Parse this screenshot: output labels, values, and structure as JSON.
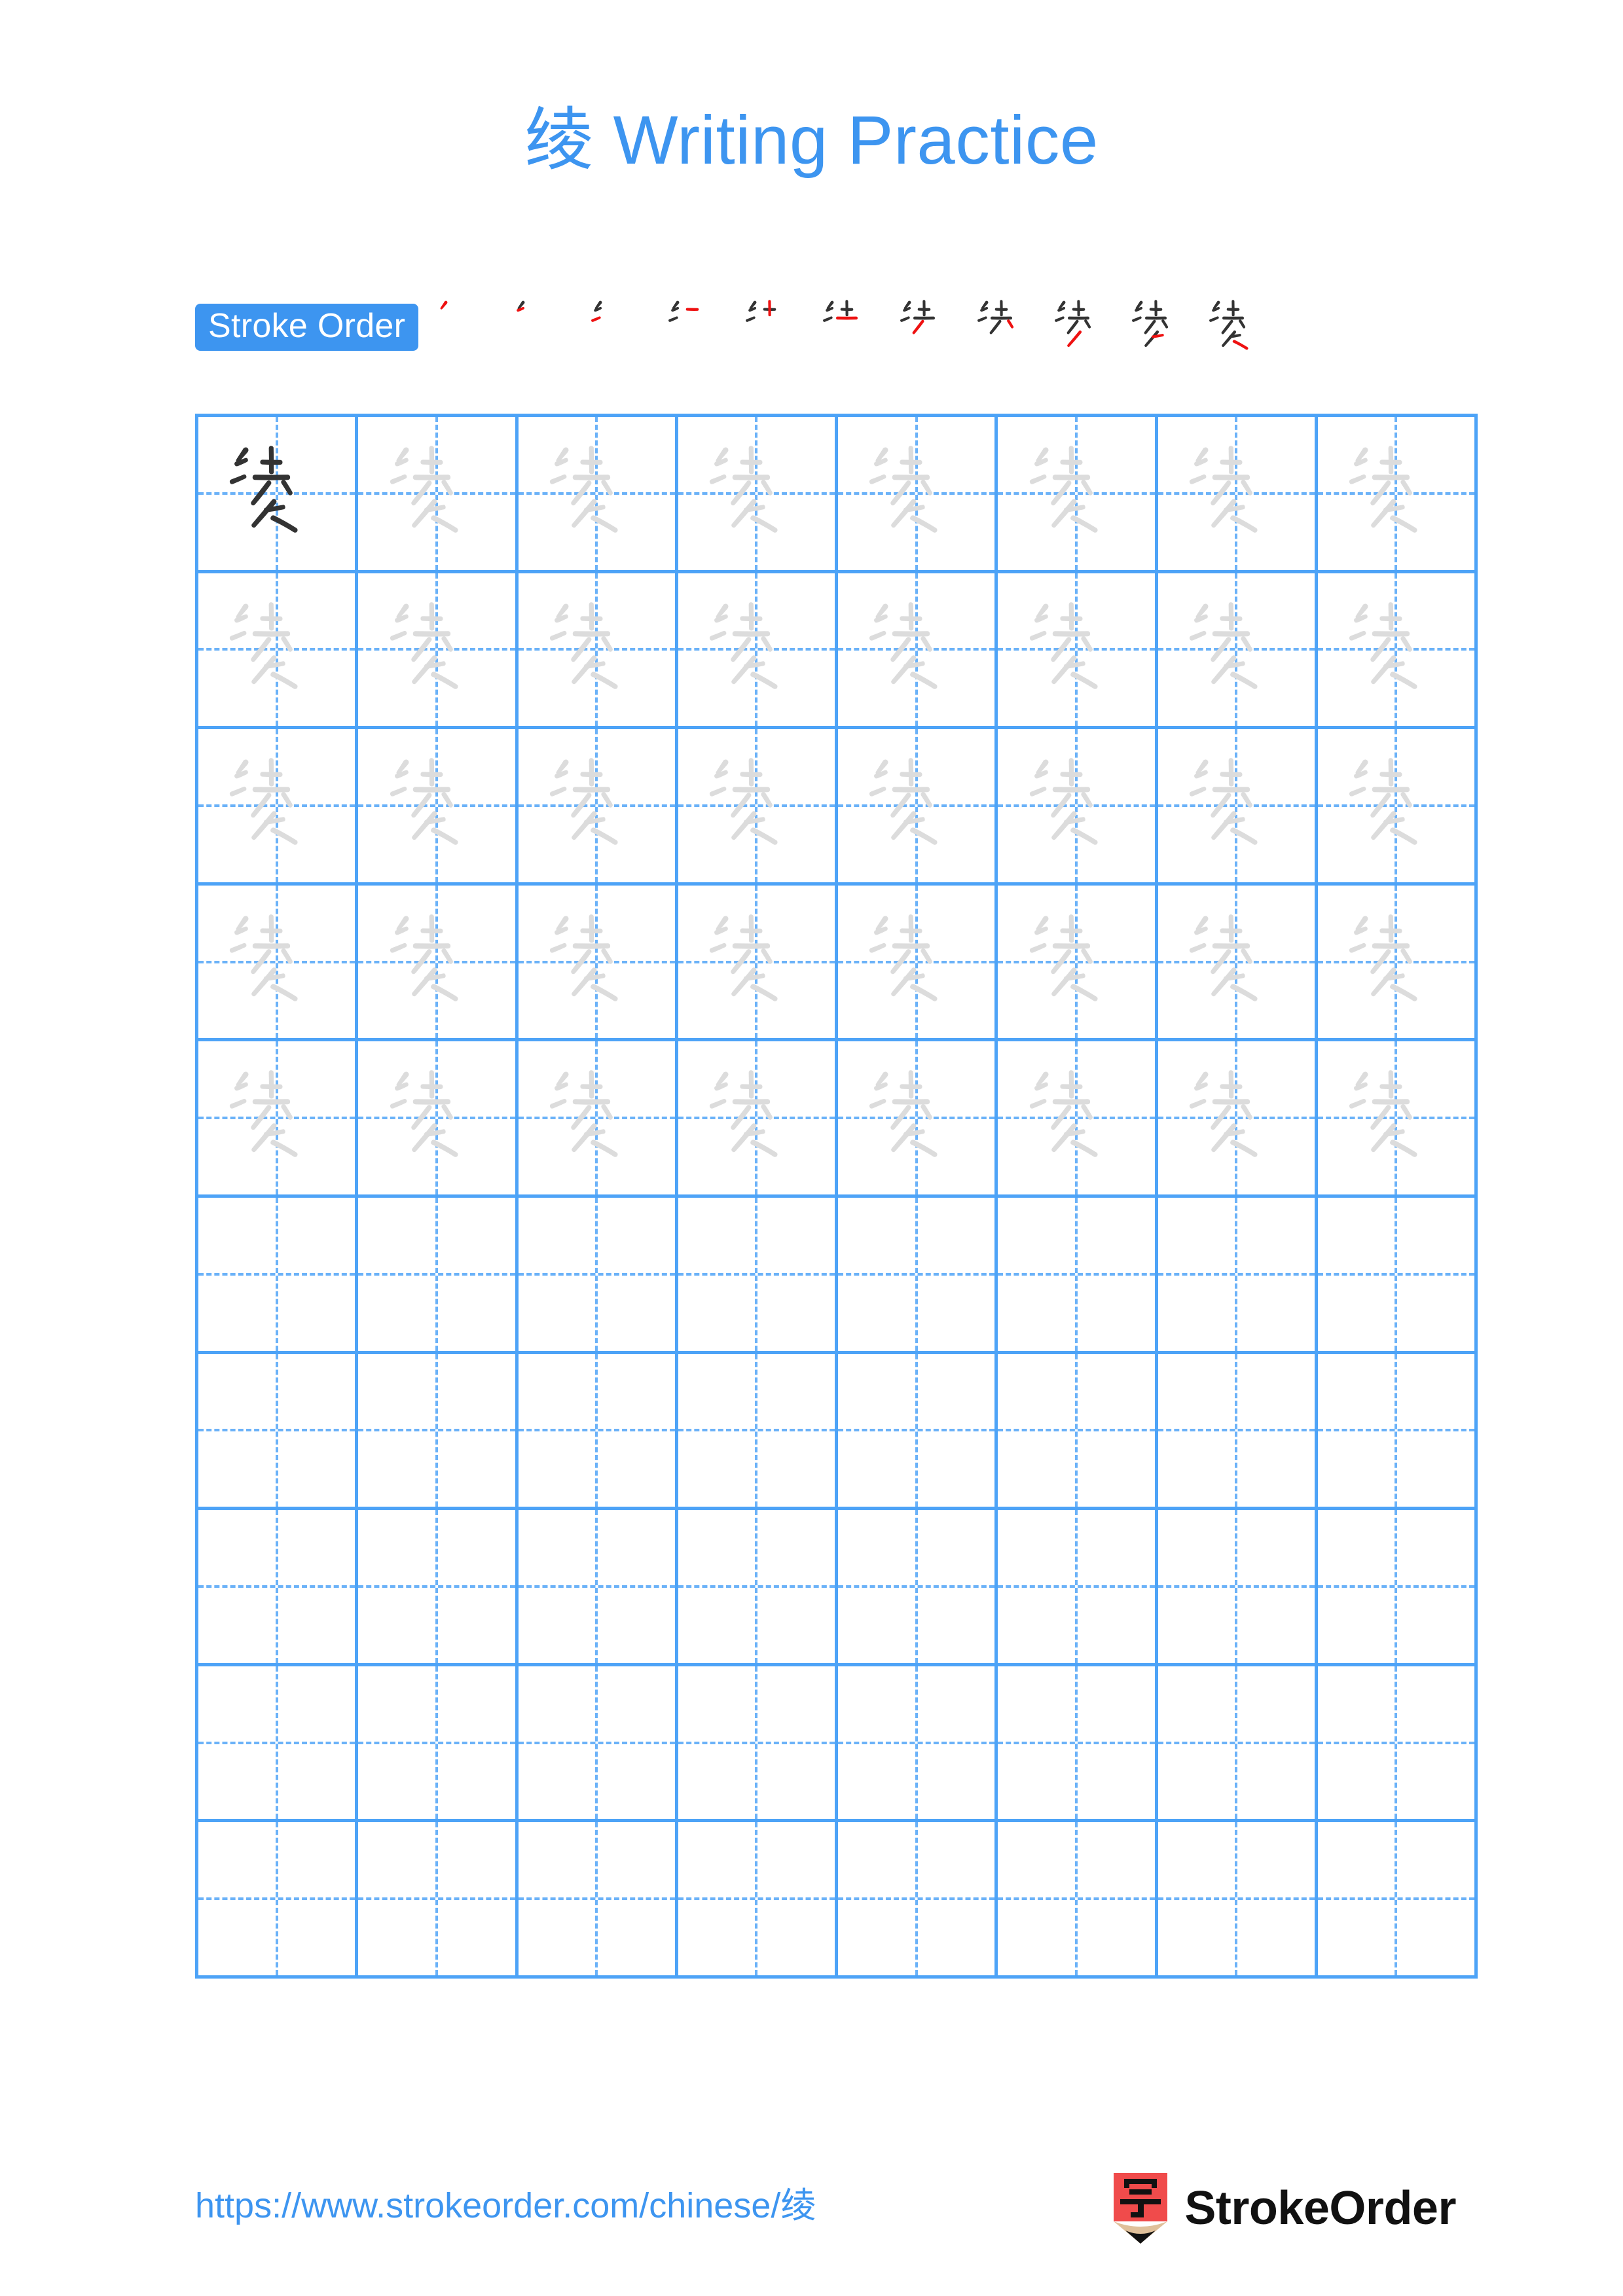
{
  "character": "绫",
  "title": "绫 Writing Practice",
  "colors": {
    "accent_blue": "#3d95f0",
    "grid_line": "#4da3f7",
    "grid_dash": "#6bb2f8",
    "model_char": "#333333",
    "trace_char": "#dcdcdc",
    "stroke_new": "#ee1111",
    "stroke_done": "#333333",
    "logo_red": "#f04b4b",
    "logo_wood": "#e0c09a"
  },
  "stroke_order": {
    "badge_label": "Stroke Order",
    "total_strokes": 11,
    "steps": [
      {
        "index": 1,
        "strokes_shown": 1,
        "label": "stroke-1"
      },
      {
        "index": 2,
        "strokes_shown": 2,
        "label": "stroke-2"
      },
      {
        "index": 3,
        "strokes_shown": 3,
        "label": "stroke-3"
      },
      {
        "index": 4,
        "strokes_shown": 4,
        "label": "stroke-4"
      },
      {
        "index": 5,
        "strokes_shown": 5,
        "label": "stroke-5"
      },
      {
        "index": 6,
        "strokes_shown": 6,
        "label": "stroke-6"
      },
      {
        "index": 7,
        "strokes_shown": 7,
        "label": "stroke-7"
      },
      {
        "index": 8,
        "strokes_shown": 8,
        "label": "stroke-8"
      },
      {
        "index": 9,
        "strokes_shown": 9,
        "label": "stroke-9"
      },
      {
        "index": 10,
        "strokes_shown": 10,
        "label": "stroke-10"
      },
      {
        "index": 11,
        "strokes_shown": 11,
        "label": "stroke-11"
      }
    ]
  },
  "grid": {
    "columns": 8,
    "rows": 10,
    "filled_rows": 5,
    "empty_rows": 5,
    "model_cell": {
      "row": 1,
      "column": 1
    },
    "cells": [
      [
        "model",
        "trace",
        "trace",
        "trace",
        "trace",
        "trace",
        "trace",
        "trace"
      ],
      [
        "trace",
        "trace",
        "trace",
        "trace",
        "trace",
        "trace",
        "trace",
        "trace"
      ],
      [
        "trace",
        "trace",
        "trace",
        "trace",
        "trace",
        "trace",
        "trace",
        "trace"
      ],
      [
        "trace",
        "trace",
        "trace",
        "trace",
        "trace",
        "trace",
        "trace",
        "trace"
      ],
      [
        "trace",
        "trace",
        "trace",
        "trace",
        "trace",
        "trace",
        "trace",
        "trace"
      ],
      [
        "empty",
        "empty",
        "empty",
        "empty",
        "empty",
        "empty",
        "empty",
        "empty"
      ],
      [
        "empty",
        "empty",
        "empty",
        "empty",
        "empty",
        "empty",
        "empty",
        "empty"
      ],
      [
        "empty",
        "empty",
        "empty",
        "empty",
        "empty",
        "empty",
        "empty",
        "empty"
      ],
      [
        "empty",
        "empty",
        "empty",
        "empty",
        "empty",
        "empty",
        "empty",
        "empty"
      ],
      [
        "empty",
        "empty",
        "empty",
        "empty",
        "empty",
        "empty",
        "empty",
        "empty"
      ]
    ]
  },
  "footer": {
    "url": "https://www.strokeorder.com/chinese/绫",
    "brand_name": "StrokeOrder",
    "logo_character": "字"
  }
}
